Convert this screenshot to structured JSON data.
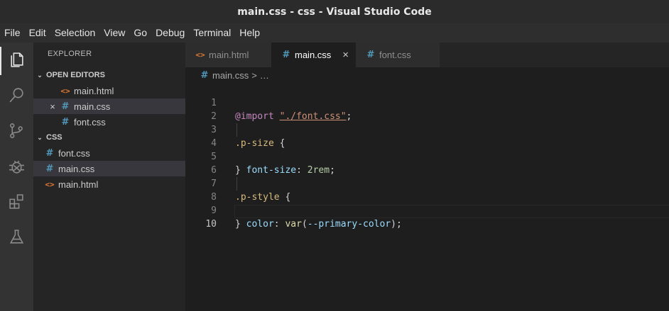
{
  "window": {
    "title": "main.css - css - Visual Studio Code"
  },
  "menu": [
    "File",
    "Edit",
    "Selection",
    "View",
    "Go",
    "Debug",
    "Terminal",
    "Help"
  ],
  "activity_bar": {
    "icons": [
      "files-icon",
      "search-icon",
      "source-control-icon",
      "debug-icon",
      "extensions-icon",
      "test-flask-icon"
    ],
    "active": "files-icon"
  },
  "sidebar": {
    "title": "EXPLORER",
    "open_editors": {
      "header": "OPEN EDITORS",
      "items": [
        {
          "name": "main.html",
          "type": "html"
        },
        {
          "name": "main.css",
          "type": "css",
          "close": "×"
        },
        {
          "name": "font.css",
          "type": "css"
        }
      ]
    },
    "folder": {
      "header": "CSS",
      "items": [
        {
          "name": "font.css",
          "type": "css"
        },
        {
          "name": "main.css",
          "type": "css"
        },
        {
          "name": "main.html",
          "type": "html"
        }
      ]
    }
  },
  "icons": {
    "html_glyph": "<>",
    "css_glyph": "#",
    "chevron": "⌄"
  },
  "tabs": [
    {
      "label": "main.html",
      "type": "html"
    },
    {
      "label": "main.css",
      "type": "css",
      "close": "×"
    },
    {
      "label": "font.css",
      "type": "css"
    }
  ],
  "breadcrumb": {
    "file": "main.css",
    "separator": ">",
    "rest": "…"
  },
  "editor": {
    "line_numbers": [
      "1",
      "2",
      "3",
      "4",
      "5",
      "6",
      "7",
      "8",
      "9",
      "10"
    ],
    "current_line": 10,
    "line1": {
      "at": "@import",
      "str": "\"./font.css\"",
      "end": ";"
    },
    "line3": {
      "sel": ".p-size",
      "brace": "{"
    },
    "line4": {
      "prop": "font-size",
      "colon": ":",
      "val": "2rem",
      "end": ";"
    },
    "line5": {
      "brace": "}"
    },
    "line7": {
      "sel": ".p-style",
      "brace": "{"
    },
    "line8": {
      "prop": "color",
      "colon": ":",
      "fn": "var",
      "open": "(",
      "arg": "--primary-color",
      "close": ")",
      "end": ";"
    },
    "line9": {
      "brace": "}"
    }
  },
  "colors": {
    "html_icon": "#e37933",
    "css_icon": "#519aba",
    "selected_row": "#37373d",
    "editor_bg": "#1e1e1e"
  }
}
